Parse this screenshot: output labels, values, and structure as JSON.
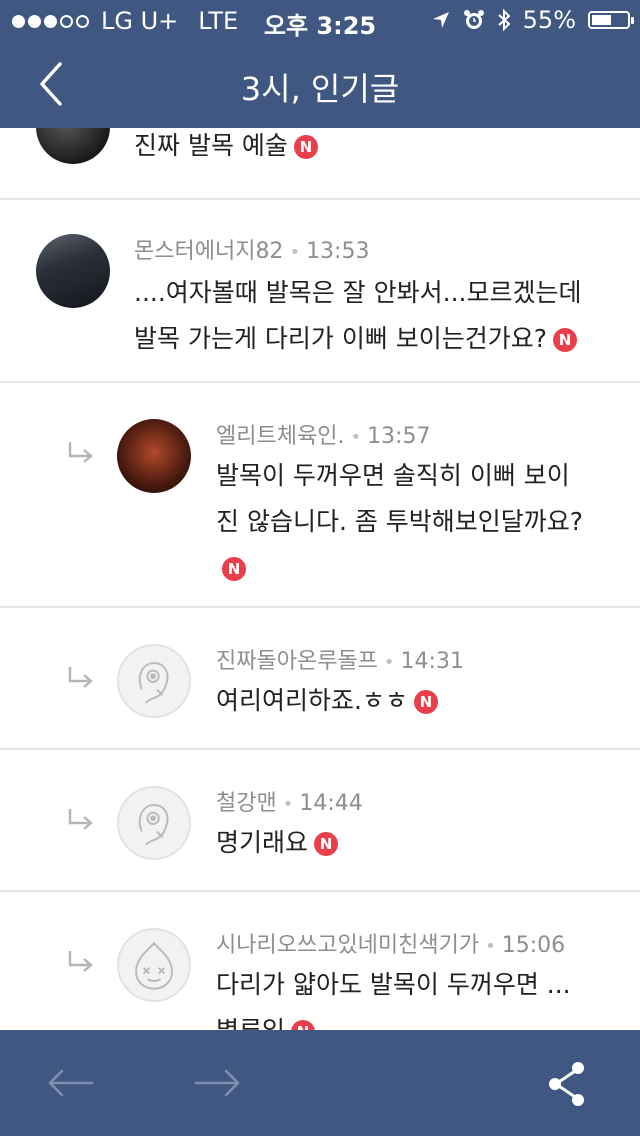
{
  "status_bar": {
    "carrier": "LG U+",
    "network": "LTE",
    "time": "오후 3:25",
    "battery": "55%",
    "battery_level": 0.55
  },
  "header": {
    "title": "3시, 인기글"
  },
  "comments": [
    {
      "author": "",
      "time": "",
      "text": "진짜 발목 예술",
      "badge": "N",
      "reply": false
    },
    {
      "author": "몬스터에너지82",
      "time": "13:53",
      "text_lines": [
        "....여자볼때 발목은 잘 안봐서...모르겠는데",
        "발목 가는게 다리가 이뻐 보이는건가요?"
      ],
      "badge": "N",
      "reply": false
    },
    {
      "author": "엘리트체육인.",
      "time": "13:57",
      "text_lines": [
        "발목이 두꺼우면 솔직히 이뻐 보이",
        "진 않습니다. 좀 투박해보인달까요?"
      ],
      "badge": "N",
      "reply": true
    },
    {
      "author": "진짜돌아온루돌프",
      "time": "14:31",
      "text": "여리여리하죠.ㅎㅎ",
      "badge": "N",
      "reply": true
    },
    {
      "author": "철강맨",
      "time": "14:44",
      "text": "명기래요",
      "badge": "N",
      "reply": true
    },
    {
      "author": "시나리오쓰고있네미친색기가",
      "time": "15:06",
      "text_lines": [
        "다리가 얇아도 발목이 두꺼우면 ...",
        "별루임"
      ],
      "badge": "N",
      "reply": true
    }
  ],
  "bottom_bar": {
    "icons": [
      "back-arrow-icon",
      "forward-arrow-icon",
      "share-icon"
    ]
  },
  "colors": {
    "bar": "#3f5781",
    "badge": "#ea3f4b"
  }
}
